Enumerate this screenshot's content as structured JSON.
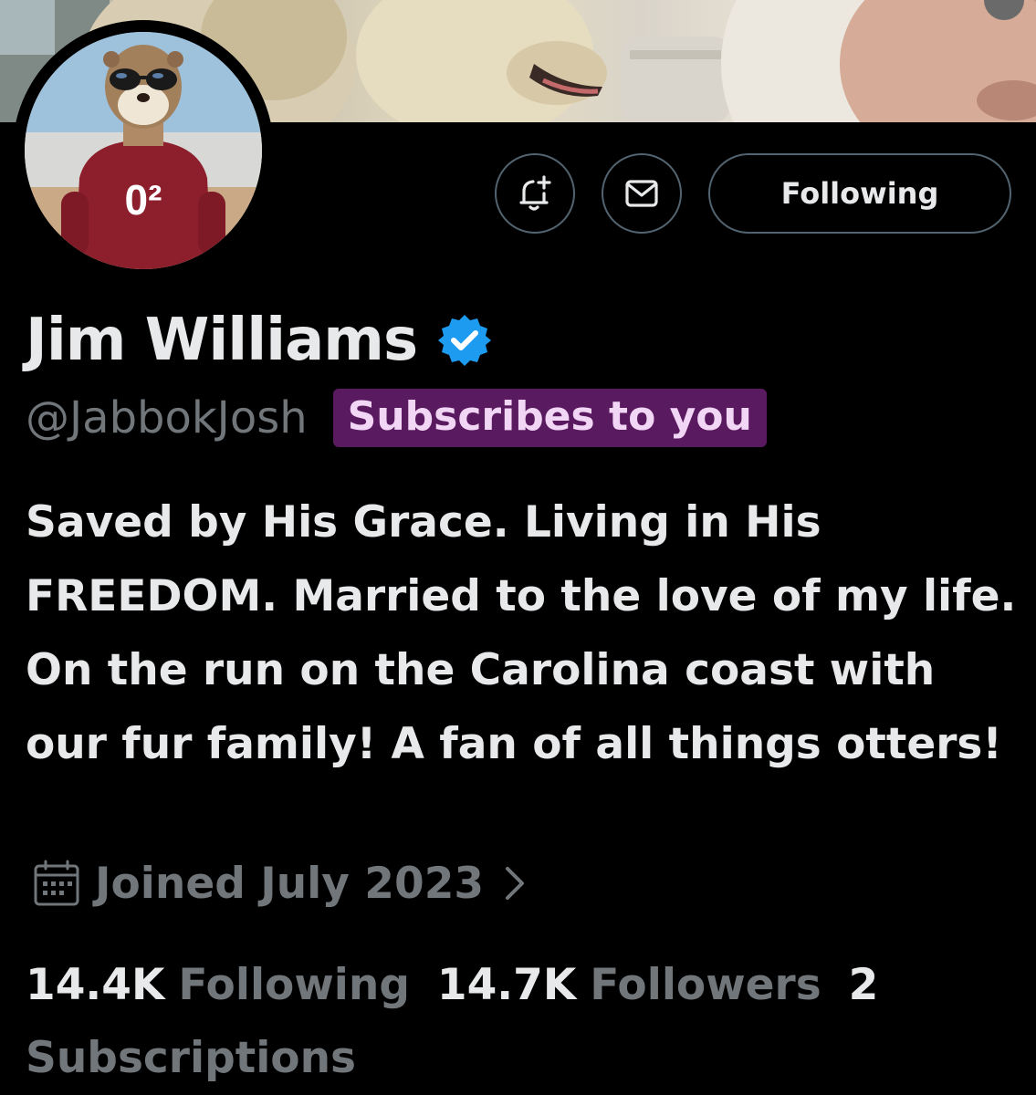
{
  "header": {
    "banner_alt": "",
    "actions": {
      "follow_label": "Following"
    }
  },
  "profile": {
    "name": "Jim Williams",
    "handle": "@JabbokJosh",
    "subscribes_badge": "Subscribes to you",
    "bio": "Saved by His Grace. Living in His FREEDOM. Married to the love of my life. On the run on the Carolina coast with our fur family! A fan of all things otters!",
    "joined": "Joined July 2023",
    "sweater_text": "0²"
  },
  "stats": {
    "following_count": "14.4K",
    "following_label": "Following",
    "followers_count": "14.7K",
    "followers_label": "Followers",
    "subscriptions_count": "2",
    "subscriptions_label": "Subscriptions"
  },
  "colors": {
    "background": "#000000",
    "text_primary": "#e7e9ea",
    "text_secondary": "#71767b",
    "verified_blue": "#1d9bf0",
    "badge_bg": "#5a1a5f",
    "badge_text": "#f2d6f5",
    "button_border": "#536471"
  },
  "icons": {
    "notify": "bell-plus-icon",
    "message": "envelope-icon",
    "verified": "verified-badge-icon",
    "calendar": "calendar-icon",
    "chevron": "chevron-right-icon"
  }
}
